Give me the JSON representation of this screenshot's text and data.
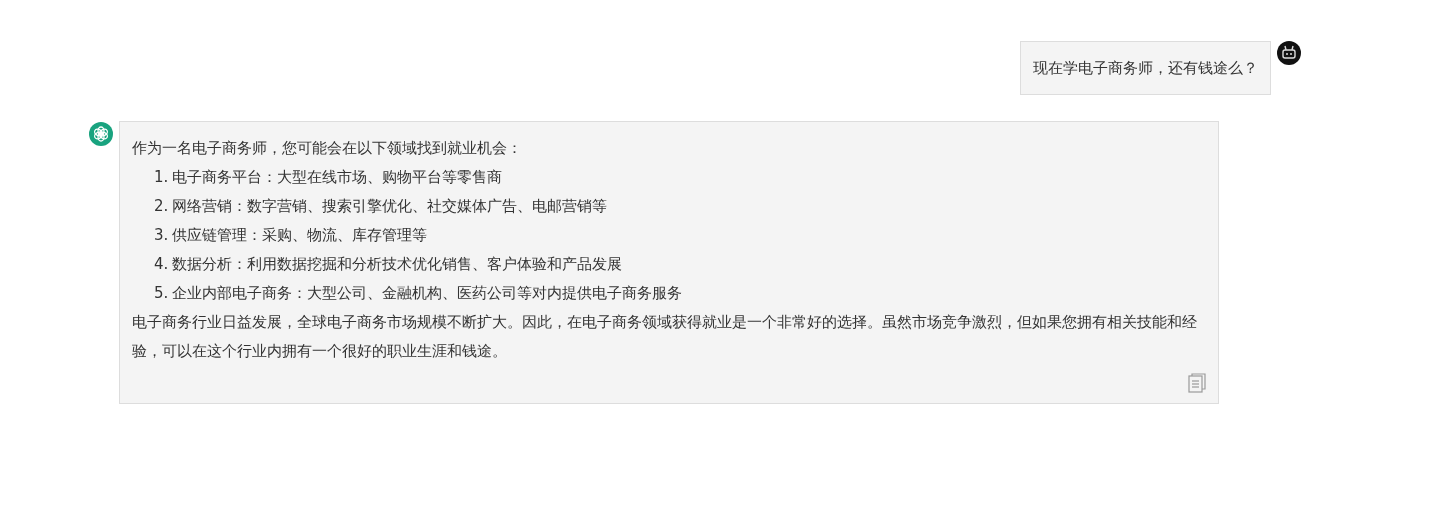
{
  "user_message": {
    "text": "现在学电子商务师，还有钱途么？"
  },
  "assistant_message": {
    "intro": "作为一名电子商务师，您可能会在以下领域找到就业机会：",
    "items": [
      {
        "number": "1.",
        "text": "电子商务平台：大型在线市场、购物平台等零售商"
      },
      {
        "number": "2.",
        "text": "网络营销：数字营销、搜索引擎优化、社交媒体广告、电邮营销等"
      },
      {
        "number": "3.",
        "text": "供应链管理：采购、物流、库存管理等"
      },
      {
        "number": "4.",
        "text": "数据分析：利用数据挖掘和分析技术优化销售、客户体验和产品发展"
      },
      {
        "number": "5.",
        "text": "企业内部电子商务：大型公司、金融机构、医药公司等对内提供电子商务服务"
      }
    ],
    "conclusion": "电子商务行业日益发展，全球电子商务市场规模不断扩大。因此，在电子商务领域获得就业是一个非常好的选择。虽然市场竞争激烈，但如果您拥有相关技能和经验，可以在这个行业内拥有一个很好的职业生涯和钱途。"
  }
}
